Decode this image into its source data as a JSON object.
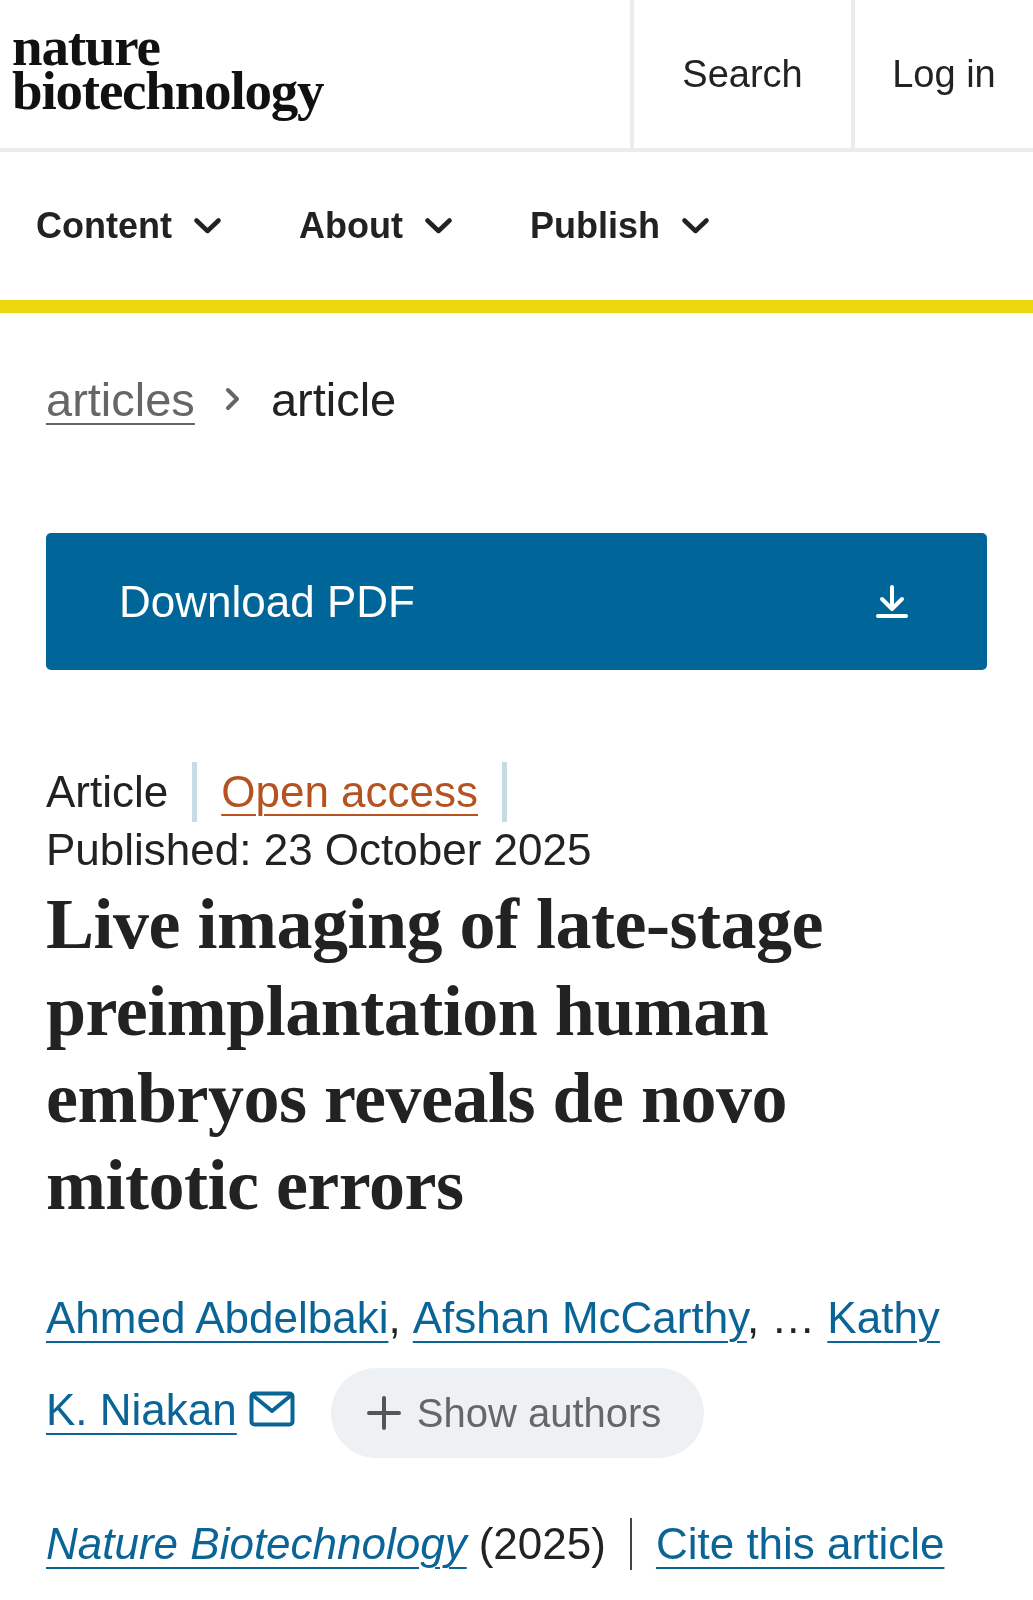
{
  "header": {
    "logo": [
      "nature",
      "biotechnology"
    ],
    "actions": [
      {
        "label": "Search"
      },
      {
        "label": "Log in"
      }
    ]
  },
  "nav": [
    {
      "label": "Content"
    },
    {
      "label": "About"
    },
    {
      "label": "Publish"
    }
  ],
  "breadcrumb": [
    {
      "label": "articles",
      "kind": "link"
    },
    {
      "label": "article",
      "kind": "current"
    }
  ],
  "download_button": {
    "label": "Download PDF"
  },
  "article_type": "Article",
  "access": "Open access",
  "published": "Published: 23 October 2025",
  "title": "Live imaging of late-stage preimplantation human embryos reveals de novo mitotic errors",
  "authors": [
    {
      "name": "Ahmed Abdelbaki",
      "separator": ",",
      "corresponding": false
    },
    {
      "name": "Afshan McCarthy",
      "separator": ", …",
      "corresponding": false
    },
    {
      "name": "Kathy K. Niakan",
      "corresponding": true
    }
  ],
  "show_authors": "Show authors",
  "journal": {
    "name": "Nature Biotechnology",
    "year": "(2025)",
    "cite": "Cite this article"
  }
}
